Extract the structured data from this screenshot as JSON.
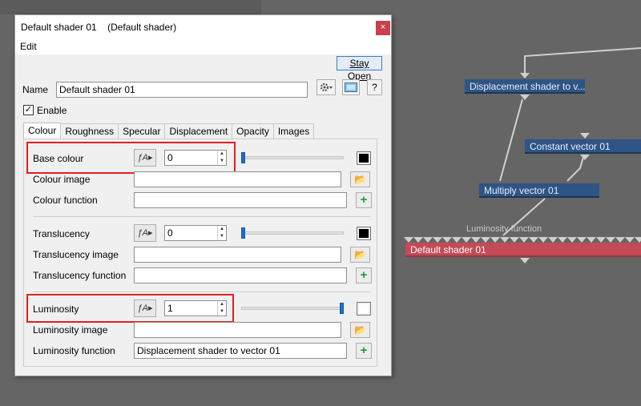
{
  "dialog": {
    "title": "Default shader 01",
    "title_type": "(Default shader)",
    "close_glyph": "×",
    "menu": {
      "edit": "Edit"
    },
    "stay_open": "Stay Open",
    "name_label": "Name",
    "name_value": "Default shader 01",
    "enable_label": "Enable",
    "enable_checked": true,
    "help_glyph": "?",
    "tabs": [
      "Colour",
      "Roughness",
      "Specular",
      "Displacement",
      "Opacity",
      "Images"
    ],
    "active_tab": "Colour",
    "sections": {
      "base": {
        "label": "Base colour",
        "value": "0",
        "slider_fraction": 0.0,
        "swatch_color": "#000000",
        "image_label": "Colour image",
        "image_value": "",
        "function_label": "Colour function",
        "function_value": ""
      },
      "translucency": {
        "label": "Translucency",
        "value": "0",
        "slider_fraction": 0.0,
        "swatch_color": "#000000",
        "image_label": "Translucency image",
        "image_value": "",
        "function_label": "Translucency function",
        "function_value": ""
      },
      "luminosity": {
        "label": "Luminosity",
        "value": "1",
        "slider_fraction": 1.0,
        "swatch_color": "#ffffff",
        "image_label": "Luminosity image",
        "image_value": "",
        "function_label": "Luminosity function",
        "function_value": "Displacement shader to vector 01"
      }
    },
    "highlight_color": "#e02020"
  },
  "graph": {
    "nodes": {
      "displacement": "Displacement shader to v...",
      "constant": "Constant vector 01",
      "multiply": "Multiply vector 01",
      "default_shader": "Default shader 01"
    },
    "input_caption": "Luminosity function",
    "node_color": "#2f5486",
    "shader_color": "#c44a57"
  }
}
